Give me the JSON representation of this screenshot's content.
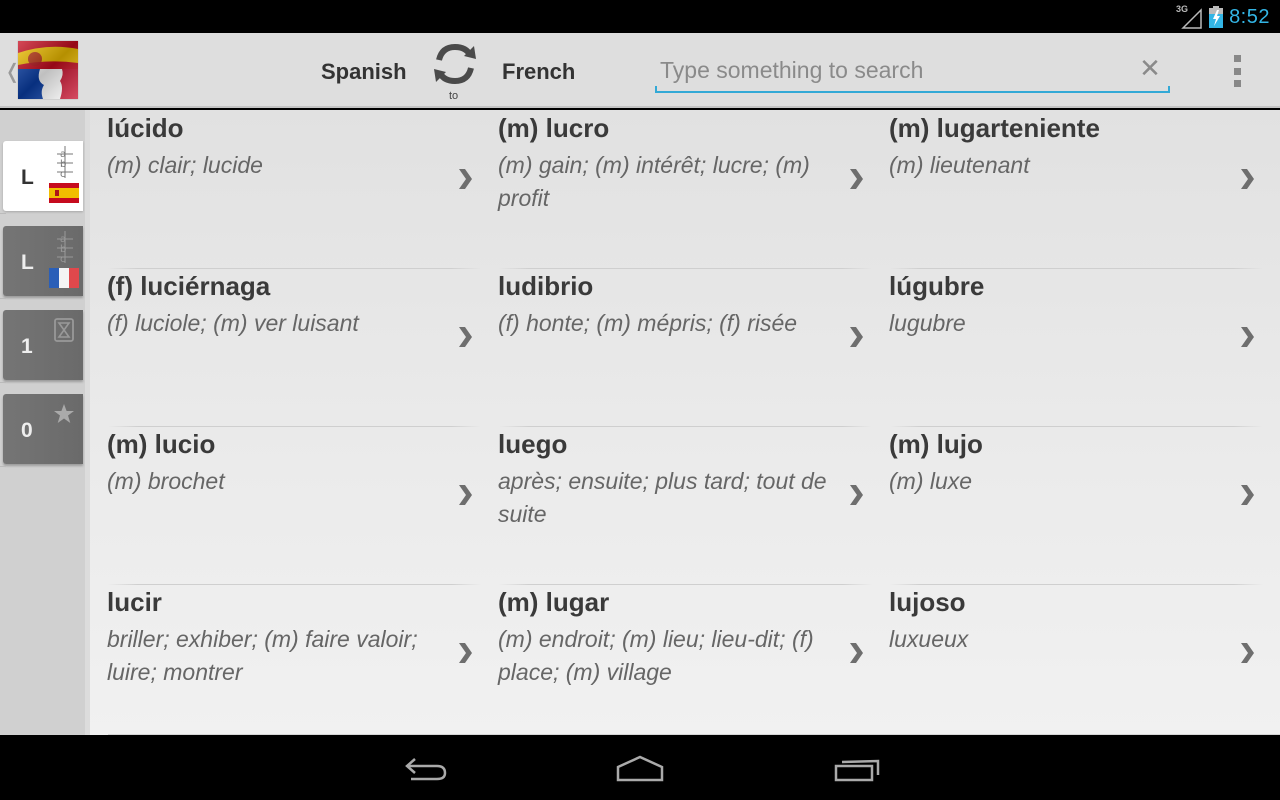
{
  "status_bar": {
    "network_label": "3G",
    "clock": "8:52",
    "accent_color": "#33b5e5"
  },
  "action_bar": {
    "up_icon": "chevron-left-icon",
    "logo": "spain-france-flag-logo",
    "source_language": "Spanish",
    "swap_icon": "swap-arrows-icon",
    "direction_label": "to",
    "target_language": "French",
    "search": {
      "value": "",
      "placeholder": "Type something to search",
      "clear_icon": "close-icon",
      "underline_color": "#33a9d6"
    },
    "overflow_icon": "overflow-menu-icon"
  },
  "sidebar": {
    "tabs": [
      {
        "label": "L",
        "icon": "abc-spain-flag-icon",
        "active": true
      },
      {
        "label": "L",
        "icon": "abc-france-flag-icon",
        "active": false
      },
      {
        "label": "1",
        "icon": "hourglass-icon",
        "active": false
      },
      {
        "label": "0",
        "icon": "star-icon",
        "active": false
      }
    ]
  },
  "entries": [
    {
      "word": "lúcido",
      "translation": "(m) clair; lucide"
    },
    {
      "word": "(m) lucro",
      "translation": "(m) gain; (m) intérêt; lucre; (m) profit"
    },
    {
      "word": "(m) lugarteniente",
      "translation": "(m) lieutenant"
    },
    {
      "word": "(f) luciérnaga",
      "translation": "(f) luciole; (m) ver luisant"
    },
    {
      "word": "ludibrio",
      "translation": "(f) honte; (m) mépris; (f) risée"
    },
    {
      "word": "lúgubre",
      "translation": "lugubre"
    },
    {
      "word": "(m) lucio",
      "translation": "(m) brochet"
    },
    {
      "word": "luego",
      "translation": "après; ensuite; plus tard; tout de suite"
    },
    {
      "word": "(m) lujo",
      "translation": "(m) luxe"
    },
    {
      "word": "lucir",
      "translation": "briller; exhiber; (m) faire valoir; luire; montrer"
    },
    {
      "word": "(m) lugar",
      "translation": "(m) endroit; (m) lieu; lieu-dit; (f) place; (m) village"
    },
    {
      "word": "lujoso",
      "translation": "luxueux"
    }
  ],
  "nav_bar": {
    "buttons": [
      "back-icon",
      "home-icon",
      "recent-apps-icon"
    ]
  }
}
